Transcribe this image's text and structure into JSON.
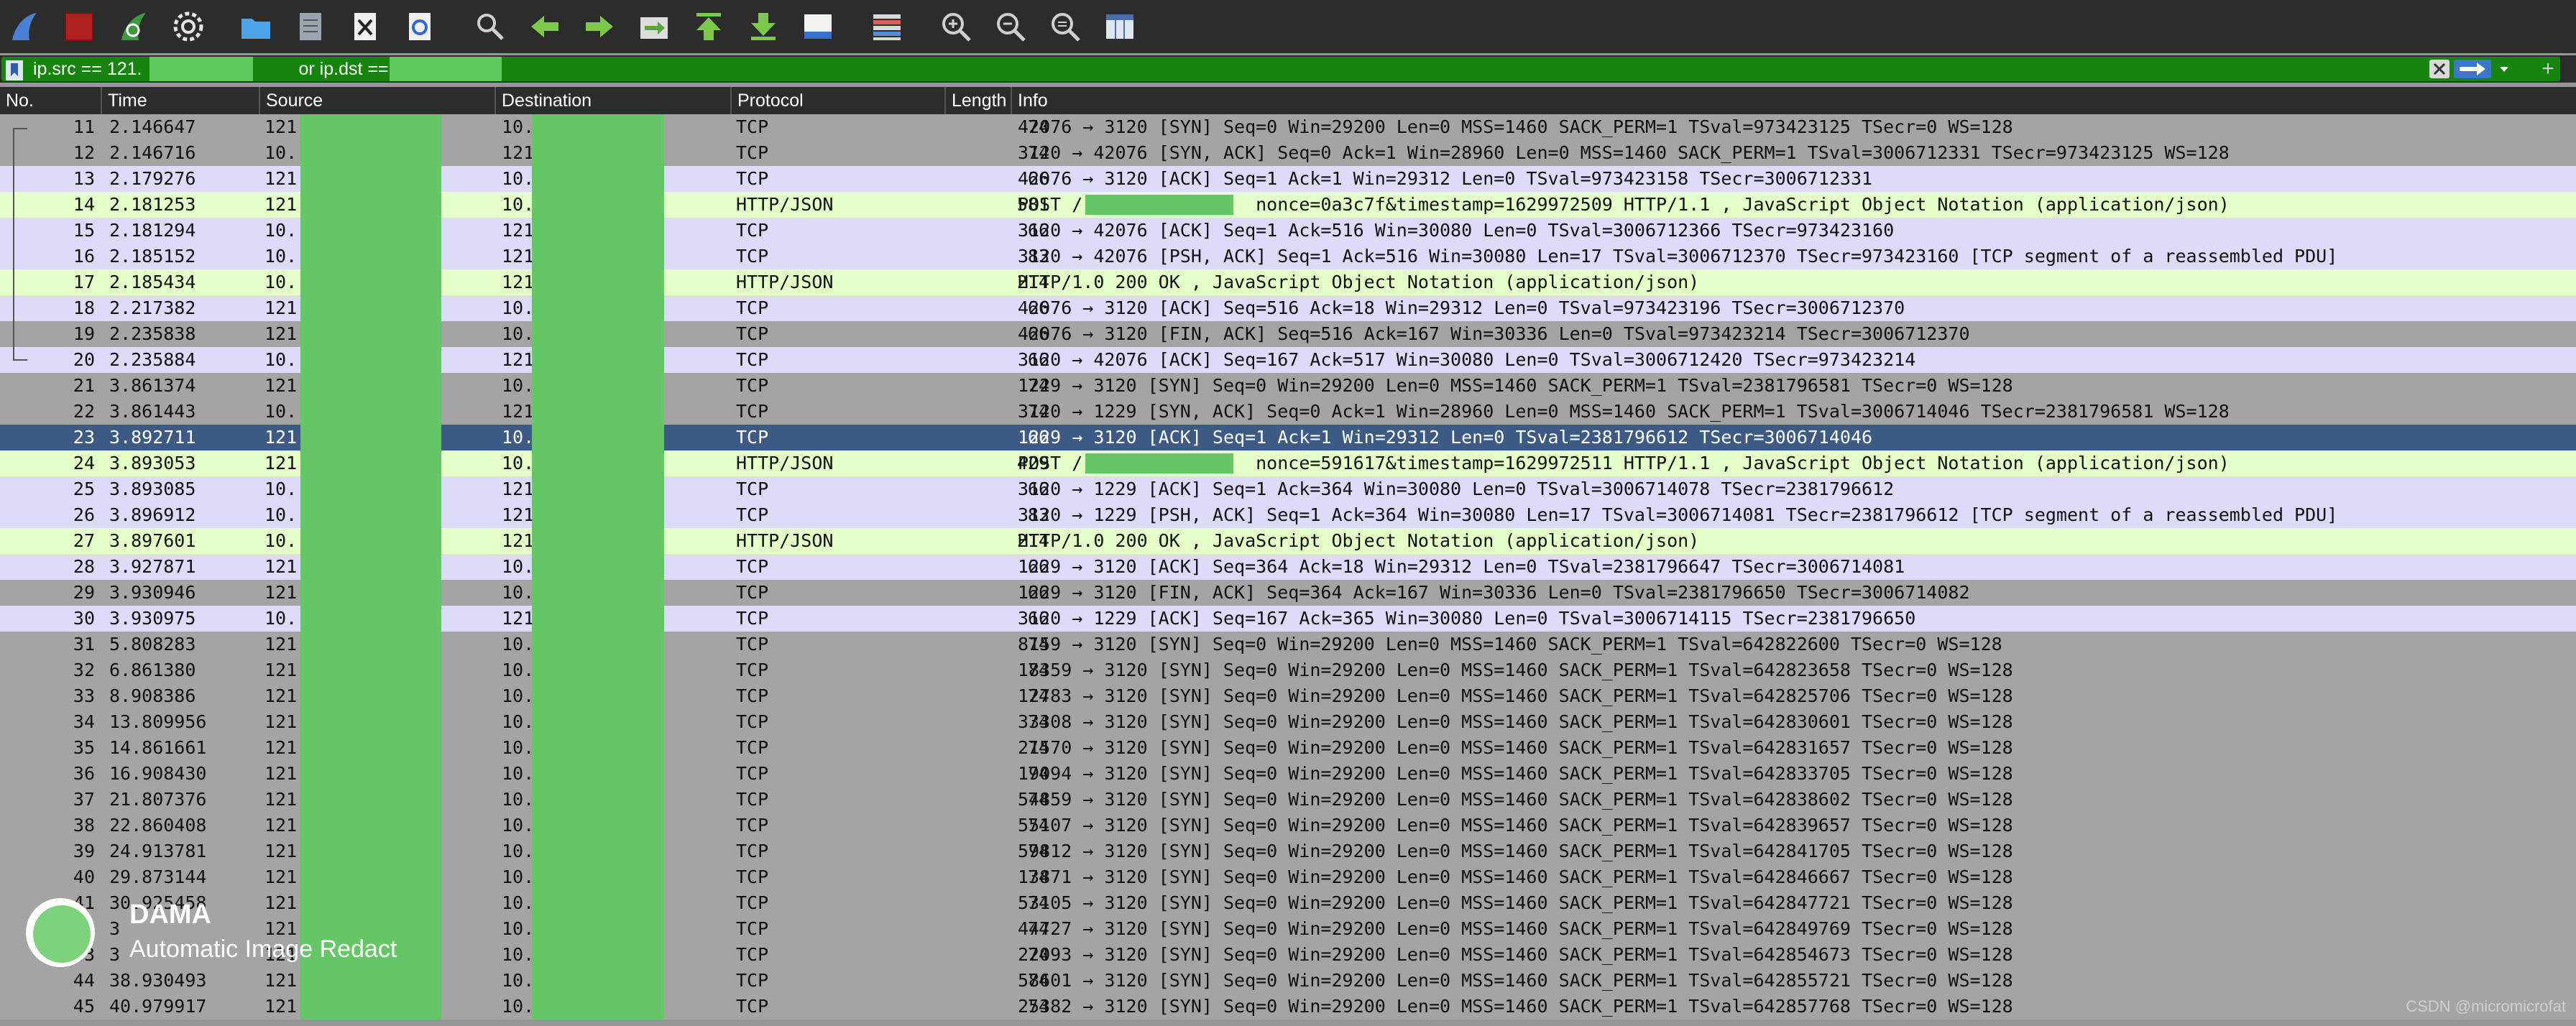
{
  "toolbar": {
    "icons": [
      "shark-fin-start-icon",
      "stop-square-icon",
      "restart-fin-icon",
      "gear-icon",
      "open-folder-icon",
      "file-icon",
      "close-file-icon",
      "reload-icon",
      "search-icon",
      "arrow-left-icon",
      "arrow-right-icon",
      "go-to-packet-icon",
      "go-first-icon",
      "go-last-icon",
      "autoscroll-icon",
      "colorize-icon",
      "zoom-in-icon",
      "zoom-out-icon",
      "zoom-normal-icon",
      "resize-columns-icon"
    ]
  },
  "filter": {
    "text_part1": "ip.src == 121.",
    "text_part2": "or ip.dst == 121",
    "add_label": "+"
  },
  "columns": {
    "no": "No.",
    "time": "Time",
    "source": "Source",
    "destination": "Destination",
    "protocol": "Protocol",
    "length": "Length",
    "info": "Info"
  },
  "colors": {
    "tcp_even": "#a4a4a4",
    "tcp_odd": "#dcdcfa",
    "http": "#e4ffc7",
    "selected": "#3d5a85",
    "redact": "#65c665",
    "filter_bg": "#16850e"
  },
  "rows": [
    {
      "no": "11",
      "time": "2.146647",
      "src": "121",
      "dst": "10.",
      "proto": "TCP",
      "len": "74",
      "info": "42076 → 3120 [SYN] Seq=0 Win=29200 Len=0 MSS=1460 SACK_PERM=1 TSval=973423125 TSecr=0 WS=128",
      "kind": "a"
    },
    {
      "no": "12",
      "time": "2.146716",
      "src": "10.",
      "dst": "121",
      "proto": "TCP",
      "len": "74",
      "info": "3120 → 42076 [SYN, ACK] Seq=0 Ack=1 Win=28960 Len=0 MSS=1460 SACK_PERM=1 TSval=3006712331 TSecr=973423125 WS=128",
      "kind": "a"
    },
    {
      "no": "13",
      "time": "2.179276",
      "src": "121",
      "dst": "10.",
      "proto": "TCP",
      "len": "66",
      "info": "42076 → 3120 [ACK] Seq=1 Ack=1 Win=29312 Len=0 TSval=973423158 TSecr=3006712331",
      "kind": "b"
    },
    {
      "no": "14",
      "time": "2.181253",
      "src": "121",
      "dst": "10.",
      "proto": "HTTP/JSON",
      "len": "581",
      "info": "POST /                nonce=0a3c7f&timestamp=1629972509 HTTP/1.1 , JavaScript Object Notation (application/json)",
      "kind": "h"
    },
    {
      "no": "15",
      "time": "2.181294",
      "src": "10.",
      "dst": "121",
      "proto": "TCP",
      "len": "66",
      "info": "3120 → 42076 [ACK] Seq=1 Ack=516 Win=30080 Len=0 TSval=3006712366 TSecr=973423160",
      "kind": "b"
    },
    {
      "no": "16",
      "time": "2.185152",
      "src": "10.",
      "dst": "121",
      "proto": "TCP",
      "len": "83",
      "info": "3120 → 42076 [PSH, ACK] Seq=1 Ack=516 Win=30080 Len=17 TSval=3006712370 TSecr=973423160 [TCP segment of a reassembled PDU]",
      "kind": "b"
    },
    {
      "no": "17",
      "time": "2.185434",
      "src": "10.",
      "dst": "121",
      "proto": "HTTP/JSON",
      "len": "214",
      "info": "HTTP/1.0 200 OK , JavaScript Object Notation (application/json)",
      "kind": "h"
    },
    {
      "no": "18",
      "time": "2.217382",
      "src": "121",
      "dst": "10.",
      "proto": "TCP",
      "len": "66",
      "info": "42076 → 3120 [ACK] Seq=516 Ack=18 Win=29312 Len=0 TSval=973423196 TSecr=3006712370",
      "kind": "b"
    },
    {
      "no": "19",
      "time": "2.235838",
      "src": "121",
      "dst": "10.",
      "proto": "TCP",
      "len": "66",
      "info": "42076 → 3120 [FIN, ACK] Seq=516 Ack=167 Win=30336 Len=0 TSval=973423214 TSecr=3006712370",
      "kind": "a"
    },
    {
      "no": "20",
      "time": "2.235884",
      "src": "10.",
      "dst": "121",
      "proto": "TCP",
      "len": "66",
      "info": "3120 → 42076 [ACK] Seq=167 Ack=517 Win=30080 Len=0 TSval=3006712420 TSecr=973423214",
      "kind": "b"
    },
    {
      "no": "21",
      "time": "3.861374",
      "src": "121",
      "dst": "10.",
      "proto": "TCP",
      "len": "74",
      "info": "1229 → 3120 [SYN] Seq=0 Win=29200 Len=0 MSS=1460 SACK_PERM=1 TSval=2381796581 TSecr=0 WS=128",
      "kind": "a"
    },
    {
      "no": "22",
      "time": "3.861443",
      "src": "10.",
      "dst": "121",
      "proto": "TCP",
      "len": "74",
      "info": "3120 → 1229 [SYN, ACK] Seq=0 Ack=1 Win=28960 Len=0 MSS=1460 SACK_PERM=1 TSval=3006714046 TSecr=2381796581 WS=128",
      "kind": "a"
    },
    {
      "no": "23",
      "time": "3.892711",
      "src": "121",
      "dst": "10.",
      "proto": "TCP",
      "len": "66",
      "info": "1229 → 3120 [ACK] Seq=1 Ack=1 Win=29312 Len=0 TSval=2381796612 TSecr=3006714046",
      "kind": "s"
    },
    {
      "no": "24",
      "time": "3.893053",
      "src": "121",
      "dst": "10.",
      "proto": "HTTP/JSON",
      "len": "429",
      "info": "POST /                nonce=591617&timestamp=1629972511 HTTP/1.1 , JavaScript Object Notation (application/json)",
      "kind": "h"
    },
    {
      "no": "25",
      "time": "3.893085",
      "src": "10.",
      "dst": "121",
      "proto": "TCP",
      "len": "66",
      "info": "3120 → 1229 [ACK] Seq=1 Ack=364 Win=30080 Len=0 TSval=3006714078 TSecr=2381796612",
      "kind": "b"
    },
    {
      "no": "26",
      "time": "3.896912",
      "src": "10.",
      "dst": "121",
      "proto": "TCP",
      "len": "83",
      "info": "3120 → 1229 [PSH, ACK] Seq=1 Ack=364 Win=30080 Len=17 TSval=3006714081 TSecr=2381796612 [TCP segment of a reassembled PDU]",
      "kind": "b"
    },
    {
      "no": "27",
      "time": "3.897601",
      "src": "10.",
      "dst": "121",
      "proto": "HTTP/JSON",
      "len": "214",
      "info": "HTTP/1.0 200 OK , JavaScript Object Notation (application/json)",
      "kind": "h"
    },
    {
      "no": "28",
      "time": "3.927871",
      "src": "121",
      "dst": "10.",
      "proto": "TCP",
      "len": "66",
      "info": "1229 → 3120 [ACK] Seq=364 Ack=18 Win=29312 Len=0 TSval=2381796647 TSecr=3006714081",
      "kind": "b"
    },
    {
      "no": "29",
      "time": "3.930946",
      "src": "121",
      "dst": "10.",
      "proto": "TCP",
      "len": "66",
      "info": "1229 → 3120 [FIN, ACK] Seq=364 Ack=167 Win=30336 Len=0 TSval=2381796650 TSecr=3006714082",
      "kind": "a"
    },
    {
      "no": "30",
      "time": "3.930975",
      "src": "10.",
      "dst": "121",
      "proto": "TCP",
      "len": "66",
      "info": "3120 → 1229 [ACK] Seq=167 Ack=365 Win=30080 Len=0 TSval=3006714115 TSecr=2381796650",
      "kind": "b"
    },
    {
      "no": "31",
      "time": "5.808283",
      "src": "121",
      "dst": "10.",
      "proto": "TCP",
      "len": "74",
      "info": "8159 → 3120 [SYN] Seq=0 Win=29200 Len=0 MSS=1460 SACK_PERM=1 TSval=642822600 TSecr=0 WS=128",
      "kind": "a"
    },
    {
      "no": "32",
      "time": "6.861380",
      "src": "121",
      "dst": "10.",
      "proto": "TCP",
      "len": "74",
      "info": "18359 → 3120 [SYN] Seq=0 Win=29200 Len=0 MSS=1460 SACK_PERM=1 TSval=642823658 TSecr=0 WS=128",
      "kind": "a"
    },
    {
      "no": "33",
      "time": "8.908386",
      "src": "121",
      "dst": "10.",
      "proto": "TCP",
      "len": "74",
      "info": "12783 → 3120 [SYN] Seq=0 Win=29200 Len=0 MSS=1460 SACK_PERM=1 TSval=642825706 TSecr=0 WS=128",
      "kind": "a"
    },
    {
      "no": "34",
      "time": "13.809956",
      "src": "121",
      "dst": "10.",
      "proto": "TCP",
      "len": "74",
      "info": "33308 → 3120 [SYN] Seq=0 Win=29200 Len=0 MSS=1460 SACK_PERM=1 TSval=642830601 TSecr=0 WS=128",
      "kind": "a"
    },
    {
      "no": "35",
      "time": "14.861661",
      "src": "121",
      "dst": "10.",
      "proto": "TCP",
      "len": "74",
      "info": "21570 → 3120 [SYN] Seq=0 Win=29200 Len=0 MSS=1460 SACK_PERM=1 TSval=642831657 TSecr=0 WS=128",
      "kind": "a"
    },
    {
      "no": "36",
      "time": "16.908430",
      "src": "121",
      "dst": "10.",
      "proto": "TCP",
      "len": "74",
      "info": "19094 → 3120 [SYN] Seq=0 Win=29200 Len=0 MSS=1460 SACK_PERM=1 TSval=642833705 TSecr=0 WS=128",
      "kind": "a"
    },
    {
      "no": "37",
      "time": "21.807376",
      "src": "121",
      "dst": "10.",
      "proto": "TCP",
      "len": "74",
      "info": "54859 → 3120 [SYN] Seq=0 Win=29200 Len=0 MSS=1460 SACK_PERM=1 TSval=642838602 TSecr=0 WS=128",
      "kind": "a"
    },
    {
      "no": "38",
      "time": "22.860408",
      "src": "121",
      "dst": "10.",
      "proto": "TCP",
      "len": "74",
      "info": "55107 → 3120 [SYN] Seq=0 Win=29200 Len=0 MSS=1460 SACK_PERM=1 TSval=642839657 TSecr=0 WS=128",
      "kind": "a"
    },
    {
      "no": "39",
      "time": "24.913781",
      "src": "121",
      "dst": "10.",
      "proto": "TCP",
      "len": "74",
      "info": "59812 → 3120 [SYN] Seq=0 Win=29200 Len=0 MSS=1460 SACK_PERM=1 TSval=642841705 TSecr=0 WS=128",
      "kind": "a"
    },
    {
      "no": "40",
      "time": "29.873144",
      "src": "121",
      "dst": "10.",
      "proto": "TCP",
      "len": "74",
      "info": "13871 → 3120 [SYN] Seq=0 Win=29200 Len=0 MSS=1460 SACK_PERM=1 TSval=642846667 TSecr=0 WS=128",
      "kind": "a"
    },
    {
      "no": "41",
      "time": "30.925458",
      "src": "121",
      "dst": "10.",
      "proto": "TCP",
      "len": "74",
      "info": "53105 → 3120 [SYN] Seq=0 Win=29200 Len=0 MSS=1460 SACK_PERM=1 TSval=642847721 TSecr=0 WS=128",
      "kind": "a"
    },
    {
      "no": "42",
      "time": "3",
      "src": "121",
      "dst": "10.",
      "proto": "TCP",
      "len": "74",
      "info": "44727 → 3120 [SYN] Seq=0 Win=29200 Len=0 MSS=1460 SACK_PERM=1 TSval=642849769 TSecr=0 WS=128",
      "kind": "a"
    },
    {
      "no": "43",
      "time": "3",
      "src": "121",
      "dst": "10.",
      "proto": "TCP",
      "len": "74",
      "info": "22093 → 3120 [SYN] Seq=0 Win=29200 Len=0 MSS=1460 SACK_PERM=1 TSval=642854673 TSecr=0 WS=128",
      "kind": "a"
    },
    {
      "no": "44",
      "time": "38.930493",
      "src": "121",
      "dst": "10.",
      "proto": "TCP",
      "len": "74",
      "info": "58601 → 3120 [SYN] Seq=0 Win=29200 Len=0 MSS=1460 SACK_PERM=1 TSval=642855721 TSecr=0 WS=128",
      "kind": "a"
    },
    {
      "no": "45",
      "time": "40.979917",
      "src": "121",
      "dst": "10.",
      "proto": "TCP",
      "len": "74",
      "info": "25382 → 3120 [SYN] Seq=0 Win=29200 Len=0 MSS=1460 SACK_PERM=1 TSval=642857768 TSecr=0 WS=128",
      "kind": "a"
    }
  ],
  "watermark": {
    "title": "DAMA",
    "subtitle": "Automatic Image Redact"
  },
  "footer": {
    "credit": "CSDN @micromicrofat"
  }
}
